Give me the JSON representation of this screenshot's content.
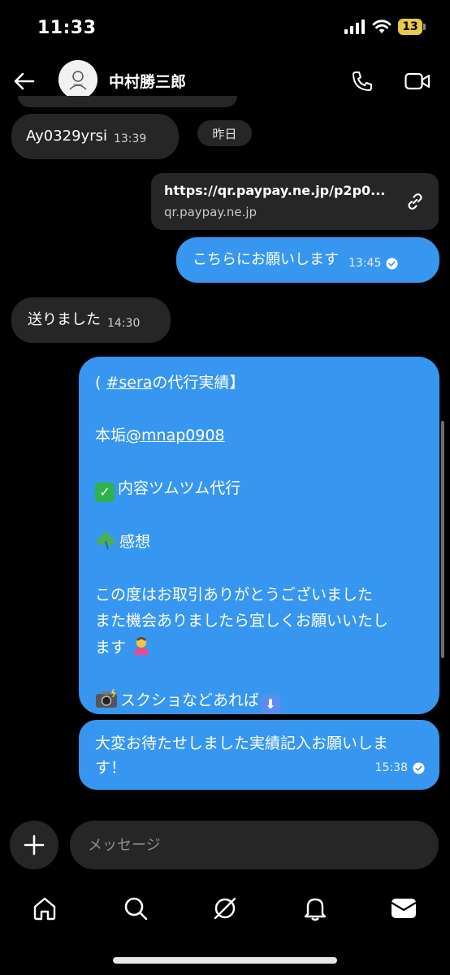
{
  "status_bar": {
    "time": "11:33",
    "battery_level": "13",
    "battery_color": "#e9c94b"
  },
  "header": {
    "contact_name": "中村勝三郎",
    "icons": [
      "back-arrow-icon",
      "phone-icon",
      "video-call-icon"
    ]
  },
  "colors": {
    "outgoing_bubble": "#3797f0",
    "incoming_bubble": "#262626",
    "background": "#000000"
  },
  "messages": [
    {
      "direction": "incoming",
      "text": "Ay0329yrsi",
      "time": "13:39"
    },
    {
      "type": "date_separator",
      "text": "昨日"
    },
    {
      "direction": "outgoing",
      "type": "link",
      "url": "https://qr.paypay.ne.jp/p2p0...",
      "domain": "qr.paypay.ne.jp"
    },
    {
      "direction": "outgoing",
      "text": "こちらにお願いします",
      "time": "13:45",
      "status": "read"
    },
    {
      "direction": "incoming",
      "text": "送りました",
      "time": "14:30"
    },
    {
      "direction": "outgoing",
      "lines": {
        "l1_prefix": "( ",
        "l1_hashtag": "#sera",
        "l1_suffix": "の代行実績】",
        "l2_prefix": "本垢",
        "l2_mention": "@mnap0908",
        "l3_text": "内容ツムツム代行",
        "l4_text": "感想",
        "l5_text": "この度はお取引ありがとうございました",
        "l6_text": "また機会ありましたら宜しくお願いいたし",
        "l7_text": "ます",
        "l8_text": "スクショなどあれば"
      },
      "emojis": [
        "check-mark-button-emoji",
        "shamrock-emoji",
        "person-bowing-emoji",
        "camera-flash-emoji",
        "down-arrow-emoji"
      ]
    },
    {
      "direction": "outgoing",
      "line1": "大変お待たせしました実績記入お願いしま",
      "line2": "す！",
      "time": "15:38",
      "status": "read"
    }
  ],
  "composer": {
    "placeholder": "メッセージ",
    "icons": [
      "plus-icon"
    ]
  },
  "bottom_nav": {
    "items": [
      "home-icon",
      "search-icon",
      "explore-icon",
      "notifications-bell-icon",
      "inbox-icon"
    ]
  }
}
